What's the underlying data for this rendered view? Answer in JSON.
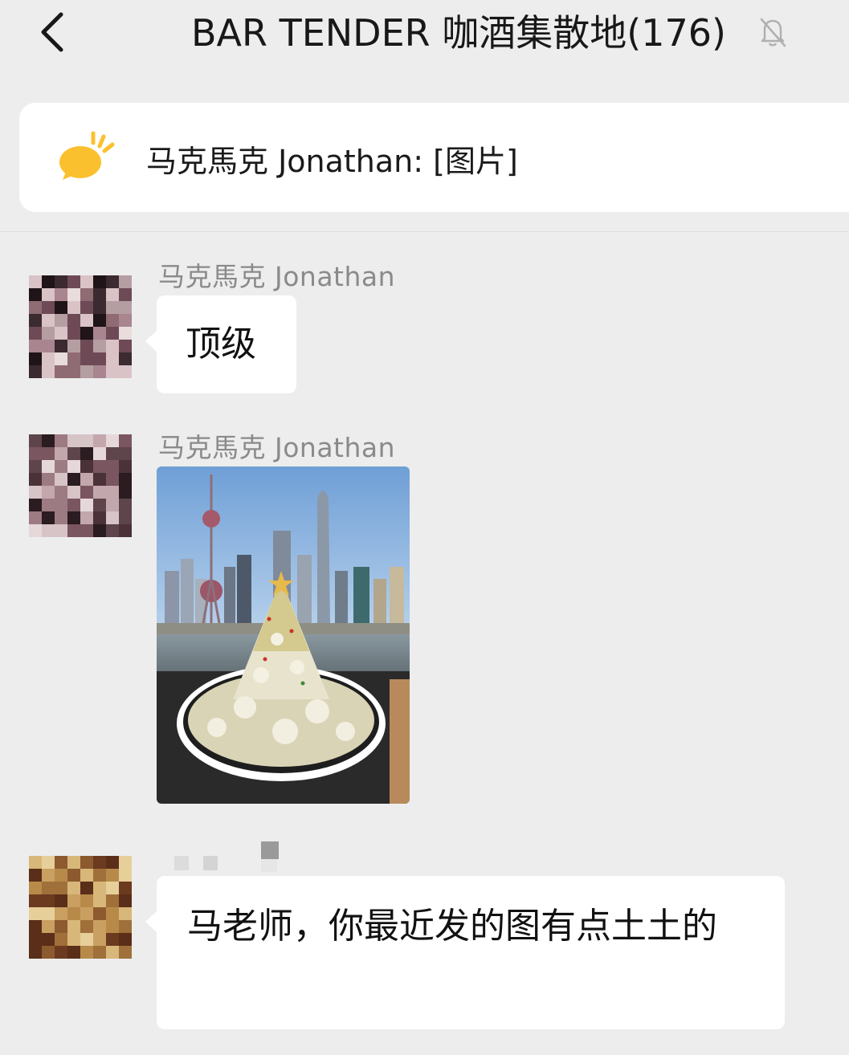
{
  "header": {
    "title": "BAR TENDER 咖酒集散地(176)",
    "back_icon": "chevron-left-icon",
    "mute_icon": "bell-muted-icon"
  },
  "notice": {
    "icon": "speech-bubble-icon",
    "text": "马克馬克 Jonathan: [图片]",
    "accent_color": "#fbc02d"
  },
  "messages": [
    {
      "sender": "马克馬克 Jonathan",
      "type": "text",
      "text": "顶级"
    },
    {
      "sender": "马克馬克 Jonathan",
      "type": "image",
      "image": "photo-shanghai-skyline-dish"
    },
    {
      "sender": "",
      "type": "text",
      "text": "马老师，你最近发的图有点土土的"
    }
  ],
  "colors": {
    "background": "#ededed",
    "bubble": "#ffffff",
    "sender": "#8a8a8a"
  }
}
